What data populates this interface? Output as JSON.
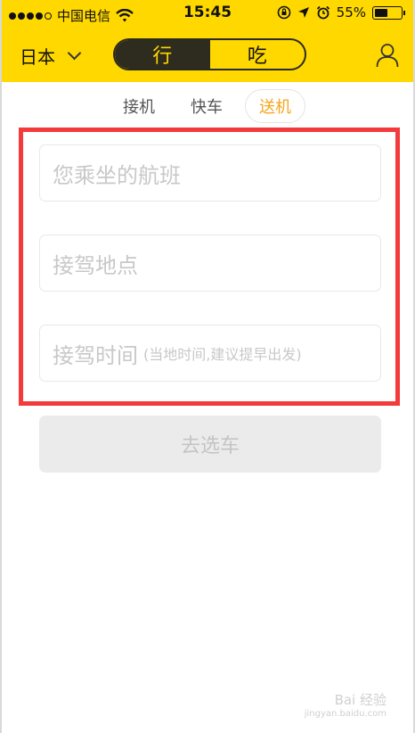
{
  "status_bar": {
    "carrier": "中国电信",
    "time": "15:45",
    "battery": "55%",
    "battery_level": 0.55
  },
  "header": {
    "country": "日本",
    "segments": [
      {
        "label": "行",
        "active": true
      },
      {
        "label": "吃",
        "active": false
      }
    ]
  },
  "subtabs": [
    {
      "label": "接机",
      "selected": false
    },
    {
      "label": "快车",
      "selected": false
    },
    {
      "label": "送机",
      "selected": true
    }
  ],
  "form": {
    "flight_placeholder": "您乘坐的航班",
    "location_placeholder": "接驾地点",
    "time_placeholder": "接驾时间",
    "time_hint": "(当地时间,建议提早出发)",
    "submit_label": "去选车"
  },
  "watermark": {
    "text": "Bai 经验",
    "url": "jingyan.baidu.com"
  },
  "colors": {
    "brand_yellow": "#ffd800",
    "accent_orange": "#f5a51c",
    "highlight_red": "#f33b3b"
  }
}
